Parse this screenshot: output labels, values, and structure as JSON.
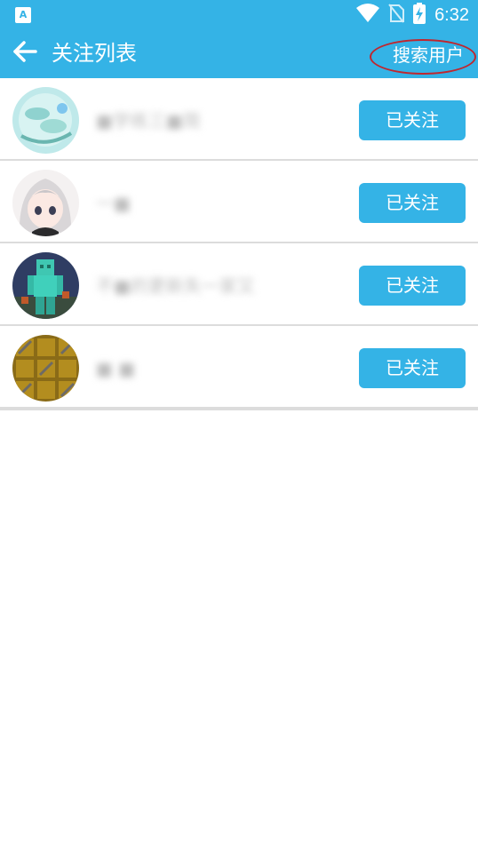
{
  "status_bar": {
    "app_icon": "a-app-icon",
    "wifi_icon": "wifi-icon",
    "no_sim_icon": "no-sim-icon",
    "battery_icon": "battery-charging-icon",
    "time": "6:32"
  },
  "app_bar": {
    "back_icon": "arrow-left-icon",
    "title": "关注列表",
    "search_user_label": "搜索用户",
    "accent_color": "#34b3e6"
  },
  "follow_list": [
    {
      "name": "■学练三■简",
      "button_label": "已关注"
    },
    {
      "name": "一■",
      "button_label": "已关注"
    },
    {
      "name": "不■的更新失一家又",
      "button_label": "已关注"
    },
    {
      "name": "■  ■",
      "button_label": "已关注"
    }
  ]
}
